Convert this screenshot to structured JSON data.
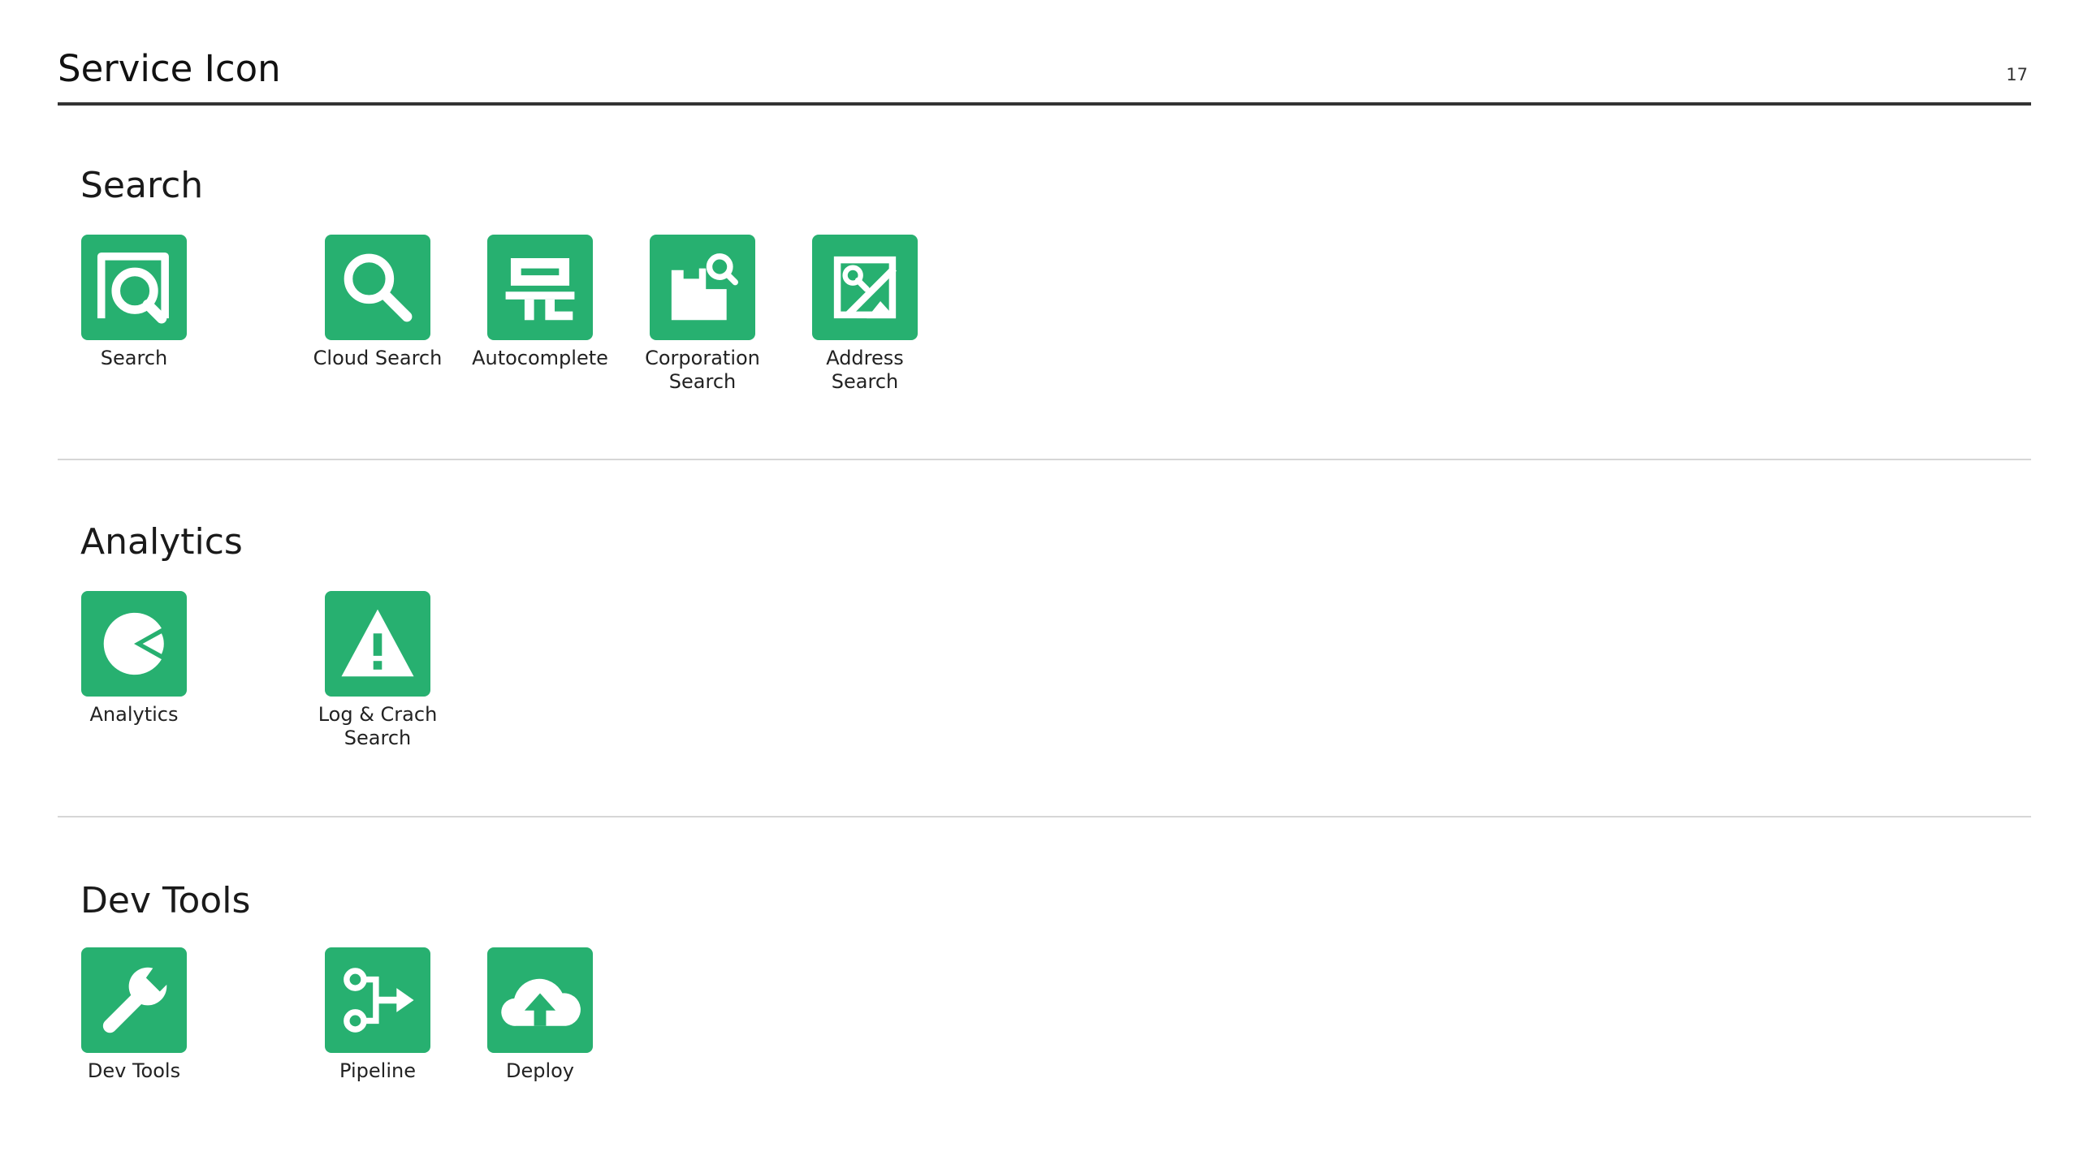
{
  "header": {
    "title": "Service Icon",
    "page_number": "17"
  },
  "colors": {
    "icon_background": "#27b070",
    "icon_glyph": "#ffffff",
    "header_rule": "#333333",
    "section_divider": "#d6d6d6"
  },
  "sections": [
    {
      "title": "Search",
      "items": [
        {
          "label": "Search",
          "icon": "search-service-icon"
        },
        {
          "label": "Cloud Search",
          "icon": "cloud-search-icon"
        },
        {
          "label": "Autocomplete",
          "icon": "autocomplete-icon"
        },
        {
          "label": "Corporation\nSearch",
          "icon": "corporation-search-icon"
        },
        {
          "label": "Address\nSearch",
          "icon": "address-search-icon"
        }
      ]
    },
    {
      "title": "Analytics",
      "items": [
        {
          "label": "Analytics",
          "icon": "analytics-icon"
        },
        {
          "label": "Log & Crach\nSearch",
          "icon": "log-crash-search-icon"
        }
      ]
    },
    {
      "title": "Dev Tools",
      "items": [
        {
          "label": "Dev Tools",
          "icon": "dev-tools-icon"
        },
        {
          "label": "Pipeline",
          "icon": "pipeline-icon"
        },
        {
          "label": "Deploy",
          "icon": "deploy-icon"
        }
      ]
    }
  ]
}
